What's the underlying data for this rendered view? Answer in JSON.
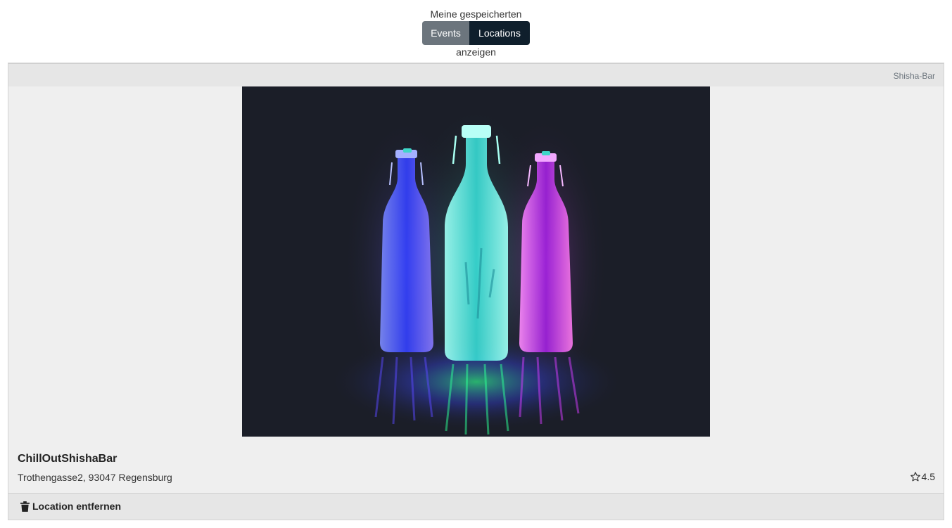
{
  "toggle": {
    "label_top": "Meine gespeicherten",
    "label_bottom": "anzeigen",
    "events_label": "Events",
    "locations_label": "Locations",
    "active": "Locations"
  },
  "location": {
    "category": "Shisha-Bar",
    "image_icon": "glowing-bottles-photo",
    "name": "ChillOutShishaBar",
    "address": "Trothengasse2, 93047 Regensburg",
    "rating_icon": "star-outline-icon",
    "rating": "4.5",
    "remove_icon": "trash-icon",
    "remove_label": "Location entfernen"
  },
  "colors": {
    "events_button": "#6c757d",
    "locations_button_active": "#0f1f2c",
    "card_background": "#efefef",
    "card_header_footer": "#e6e6e6",
    "image_background": "#1b1e28"
  }
}
